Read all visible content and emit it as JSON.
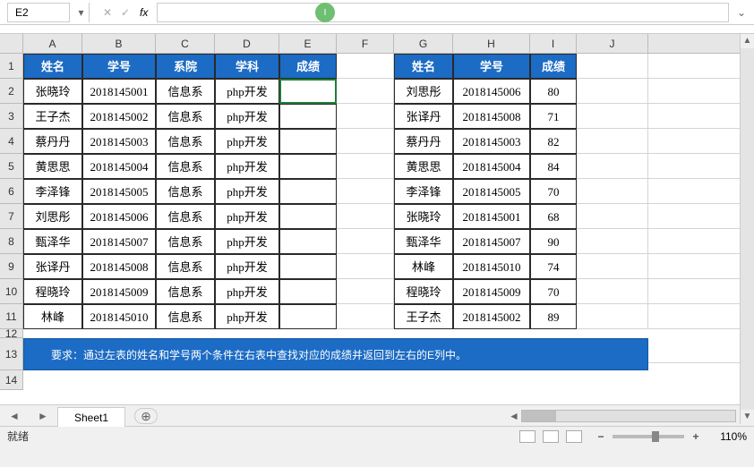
{
  "cell_ref": "E2",
  "columns": [
    "A",
    "B",
    "C",
    "D",
    "E",
    "F",
    "G",
    "H",
    "I",
    "J"
  ],
  "row_nums": [
    "1",
    "2",
    "3",
    "4",
    "5",
    "6",
    "7",
    "8",
    "9",
    "10",
    "11",
    "12",
    "13",
    "14"
  ],
  "left_headers": [
    "姓名",
    "学号",
    "系院",
    "学科",
    "成绩"
  ],
  "right_headers": [
    "姓名",
    "学号",
    "成绩"
  ],
  "left_rows": [
    {
      "name": "张晓玲",
      "id": "2018145001",
      "dept": "信息系",
      "subj": "php开发",
      "score": ""
    },
    {
      "name": "王子杰",
      "id": "2018145002",
      "dept": "信息系",
      "subj": "php开发",
      "score": ""
    },
    {
      "name": "蔡丹丹",
      "id": "2018145003",
      "dept": "信息系",
      "subj": "php开发",
      "score": ""
    },
    {
      "name": "黄思思",
      "id": "2018145004",
      "dept": "信息系",
      "subj": "php开发",
      "score": ""
    },
    {
      "name": "李泽锋",
      "id": "2018145005",
      "dept": "信息系",
      "subj": "php开发",
      "score": ""
    },
    {
      "name": "刘思彤",
      "id": "2018145006",
      "dept": "信息系",
      "subj": "php开发",
      "score": ""
    },
    {
      "name": "甄泽华",
      "id": "2018145007",
      "dept": "信息系",
      "subj": "php开发",
      "score": ""
    },
    {
      "name": "张译丹",
      "id": "2018145008",
      "dept": "信息系",
      "subj": "php开发",
      "score": ""
    },
    {
      "name": "程晓玲",
      "id": "2018145009",
      "dept": "信息系",
      "subj": "php开发",
      "score": ""
    },
    {
      "name": "林峰",
      "id": "2018145010",
      "dept": "信息系",
      "subj": "php开发",
      "score": ""
    }
  ],
  "right_rows": [
    {
      "name": "刘思彤",
      "id": "2018145006",
      "score": "80"
    },
    {
      "name": "张译丹",
      "id": "2018145008",
      "score": "71"
    },
    {
      "name": "蔡丹丹",
      "id": "2018145003",
      "score": "82"
    },
    {
      "name": "黄思思",
      "id": "2018145004",
      "score": "84"
    },
    {
      "name": "李泽锋",
      "id": "2018145005",
      "score": "70"
    },
    {
      "name": "张晓玲",
      "id": "2018145001",
      "score": "68"
    },
    {
      "name": "甄泽华",
      "id": "2018145007",
      "score": "90"
    },
    {
      "name": "林峰",
      "id": "2018145010",
      "score": "74"
    },
    {
      "name": "程晓玲",
      "id": "2018145009",
      "score": "70"
    },
    {
      "name": "王子杰",
      "id": "2018145002",
      "score": "89"
    }
  ],
  "note": "要求：通过左表的姓名和学号两个条件在右表中查找对应的成绩并返回到左右的E列中。",
  "sheet_tab": "Sheet1",
  "status": "就绪",
  "zoom": "110%",
  "fx_label": "fx",
  "cursor_char": "I"
}
